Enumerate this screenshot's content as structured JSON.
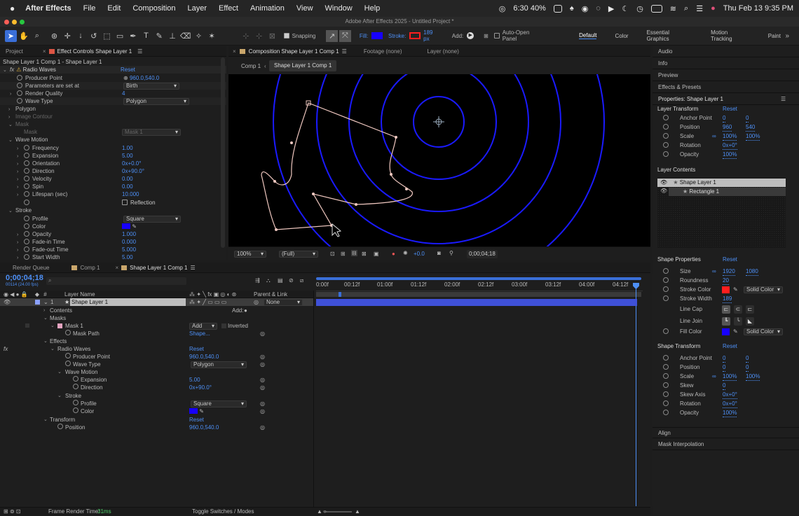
{
  "menubar": {
    "app_name": "After Effects",
    "items": [
      "File",
      "Edit",
      "Composition",
      "Layer",
      "Effect",
      "Animation",
      "View",
      "Window",
      "Help"
    ],
    "status": "6:30 40%",
    "datetime": "Thu Feb 13  9:35 PM"
  },
  "window": {
    "title": "Adobe After Effects 2025 - Untitled Project *"
  },
  "toolbar": {
    "snapping_label": "Snapping",
    "fill_label": "Fill:",
    "stroke_label": "Stroke:",
    "stroke_px": "189 px",
    "add_label": "Add:",
    "auto_open_label": "Auto-Open Panel",
    "workspaces": [
      "Default",
      "Color",
      "Essential Graphics",
      "Motion Tracking",
      "Paint"
    ],
    "fill_color": "#1700ff",
    "stroke_color": "#ff1e1e"
  },
  "project_panel": {
    "tab_project": "Project",
    "tab_effect_controls": "Effect Controls Shape Layer 1",
    "subtitle": "Shape Layer 1 Comp 1 - Shape Layer 1",
    "effect_name": "Radio Waves",
    "reset_label": "Reset",
    "rows": [
      {
        "label": "Producer Point",
        "value": "960.0,540.0"
      },
      {
        "label": "Parameters are set at",
        "value": "Birth"
      },
      {
        "label": "Render Quality",
        "value": "4"
      },
      {
        "label": "Wave Type",
        "value": "Polygon"
      },
      {
        "label": "Polygon",
        "value": ""
      },
      {
        "label": "Image Contour",
        "value": ""
      },
      {
        "label": "Mask",
        "value": ""
      },
      {
        "label": "Mask",
        "value": "Mask 1"
      },
      {
        "label": "Wave Motion",
        "value": ""
      },
      {
        "label": "Frequency",
        "value": "1.00"
      },
      {
        "label": "Expansion",
        "value": "5.00"
      },
      {
        "label": "Orientation",
        "value": "0x+0.0°"
      },
      {
        "label": "Direction",
        "value": "0x+90.0°"
      },
      {
        "label": "Velocity",
        "value": "0.00"
      },
      {
        "label": "Spin",
        "value": "0.00"
      },
      {
        "label": "Lifespan (sec)",
        "value": "10.000"
      },
      {
        "label": "",
        "value": "Reflection"
      },
      {
        "label": "Stroke",
        "value": ""
      },
      {
        "label": "Profile",
        "value": "Square"
      },
      {
        "label": "Color",
        "value": ""
      },
      {
        "label": "Opacity",
        "value": "1.000"
      },
      {
        "label": "Fade-in Time",
        "value": "0.000"
      },
      {
        "label": "Fade-out Time",
        "value": "5.000"
      },
      {
        "label": "Start Width",
        "value": "5.00"
      }
    ]
  },
  "comp_panel": {
    "tab_comp": "Composition Shape Layer 1 Comp 1",
    "tab_footage": "Footage (none)",
    "tab_layer": "Layer (none)",
    "breadcrumb_1": "Comp 1",
    "breadcrumb_2": "Shape Layer 1 Comp 1",
    "zoom": "100%",
    "resolution": "(Full)",
    "exposure": "+0.0",
    "timecode": "0;00;04;18"
  },
  "right_panel": {
    "sections_top": [
      "Audio",
      "Info",
      "Preview",
      "Effects & Presets"
    ],
    "properties_title": "Properties: Shape Layer 1",
    "layer_transform": "Layer Transform",
    "reset": "Reset",
    "lt_rows": [
      {
        "label": "Anchor Point",
        "v1": "0",
        "v2": "0"
      },
      {
        "label": "Position",
        "v1": "960",
        "v2": "540"
      },
      {
        "label": "Scale",
        "v1": "100%",
        "v2": "100%"
      },
      {
        "label": "Rotation",
        "v1": "0x+0°",
        "v2": ""
      },
      {
        "label": "Opacity",
        "v1": "100%",
        "v2": ""
      }
    ],
    "layer_contents": "Layer Contents",
    "contents_items": [
      "Shape Layer 1",
      "Rectangle 1"
    ],
    "shape_properties": "Shape Properties",
    "sp_rows": [
      {
        "label": "Size",
        "v1": "1920",
        "v2": "1080"
      },
      {
        "label": "Roundness",
        "v1": "20",
        "v2": ""
      },
      {
        "label": "Stroke Color",
        "v1": "",
        "v2": "Solid Color"
      },
      {
        "label": "Stroke Width",
        "v1": "189",
        "v2": ""
      },
      {
        "label": "Line Cap",
        "v1": "",
        "v2": ""
      },
      {
        "label": "Line Join",
        "v1": "",
        "v2": ""
      },
      {
        "label": "Fill Color",
        "v1": "",
        "v2": "Solid Color"
      }
    ],
    "shape_transform": "Shape Transform",
    "st_rows": [
      {
        "label": "Anchor Point",
        "v1": "0",
        "v2": "0"
      },
      {
        "label": "Position",
        "v1": "0",
        "v2": "0"
      },
      {
        "label": "Scale",
        "v1": "100%",
        "v2": "100%"
      },
      {
        "label": "Skew",
        "v1": "0",
        "v2": ""
      },
      {
        "label": "Skew Axis",
        "v1": "0x+0°",
        "v2": ""
      },
      {
        "label": "Rotation",
        "v1": "0x+0°",
        "v2": ""
      },
      {
        "label": "Opacity",
        "v1": "100%",
        "v2": ""
      }
    ],
    "sections_bottom": [
      "Align",
      "Mask Interpolation"
    ]
  },
  "timeline": {
    "tab_render": "Render Queue",
    "tab_comp1": "Comp 1",
    "tab_shape": "Shape Layer 1 Comp 1",
    "timecode": "0;00;04;18",
    "frames": "00114 (24.00 fps)",
    "search_placeholder": "",
    "col_layer_name": "Layer Name",
    "col_parent": "Parent & Link",
    "layer_num": "1",
    "layer_name": "Shape Layer 1",
    "parent_value": "None",
    "ruler": [
      "0:00f",
      "00:12f",
      "01:00f",
      "01:12f",
      "02:00f",
      "02:12f",
      "03:00f",
      "03:12f",
      "04:00f",
      "04:12f"
    ],
    "rows": [
      {
        "label": "Contents",
        "value": "Add:"
      },
      {
        "label": "Masks",
        "value": ""
      },
      {
        "label": "Mask 1",
        "value": "Add"
      },
      {
        "label": "Mask Path",
        "value": "Shape..."
      },
      {
        "label": "Effects",
        "value": ""
      },
      {
        "label": "Radio Waves",
        "value": "Reset"
      },
      {
        "label": "Producer Point",
        "value": "960.0,540.0"
      },
      {
        "label": "Wave Type",
        "value": "Polygon"
      },
      {
        "label": "Wave Motion",
        "value": ""
      },
      {
        "label": "Expansion",
        "value": "5.00"
      },
      {
        "label": "Direction",
        "value": "0x+90.0°"
      },
      {
        "label": "Stroke",
        "value": ""
      },
      {
        "label": "Profile",
        "value": "Square"
      },
      {
        "label": "Color",
        "value": ""
      },
      {
        "label": "Transform",
        "value": "Reset"
      },
      {
        "label": "Position",
        "value": "960.0,540.0"
      }
    ],
    "inverted_label": "Inverted",
    "render_time_label": "Frame Render Time:",
    "render_time_value": "31ms",
    "toggle_label": "Toggle Switches / Modes"
  }
}
